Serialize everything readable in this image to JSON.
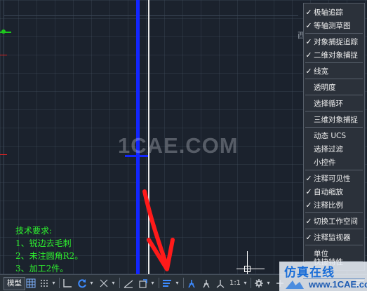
{
  "canvas": {
    "watermark": "1CAE.COM",
    "corner_label": "西"
  },
  "annotation": {
    "lines": [
      "技术要求:",
      "1、锐边去毛刺",
      "2、未注圆角R2。",
      "3、加工2件。"
    ]
  },
  "menu": {
    "items": [
      {
        "label": "极轴追踪",
        "checked": true
      },
      {
        "label": "等轴测草图",
        "checked": true
      },
      {
        "label": "对象捕捉追踪",
        "checked": true
      },
      {
        "label": "二维对象捕捉",
        "checked": true
      },
      {
        "label": "线宽",
        "checked": true
      },
      {
        "label": "透明度",
        "checked": false
      },
      {
        "label": "选择循环",
        "checked": false
      },
      {
        "label": "三维对象捕捉",
        "checked": false
      },
      {
        "label": "动态 UCS",
        "checked": false
      },
      {
        "label": "选择过滤",
        "checked": false
      },
      {
        "label": "小控件",
        "checked": false
      },
      {
        "label": "注释可见性",
        "checked": true
      },
      {
        "label": "自动缩放",
        "checked": true
      },
      {
        "label": "注释比例",
        "checked": true
      },
      {
        "label": "切换工作空间",
        "checked": true
      },
      {
        "label": "注释监视器",
        "checked": true
      },
      {
        "label": "单位",
        "checked": false
      },
      {
        "label": "快捷特性",
        "checked": false
      }
    ],
    "check_glyph": "✓"
  },
  "statusbar": {
    "model_tab": "模型",
    "scale": "1:1",
    "dropdown_glyph": "▾"
  },
  "logo": {
    "cn": "仿真在线",
    "url": "www.1CAE.com"
  },
  "colors": {
    "canvas": "#1b222d",
    "blue_line": "#1226ff",
    "annotation": "#2ef02e",
    "arrow": "#ff1a1a",
    "menu_bg": "#2b313a"
  }
}
